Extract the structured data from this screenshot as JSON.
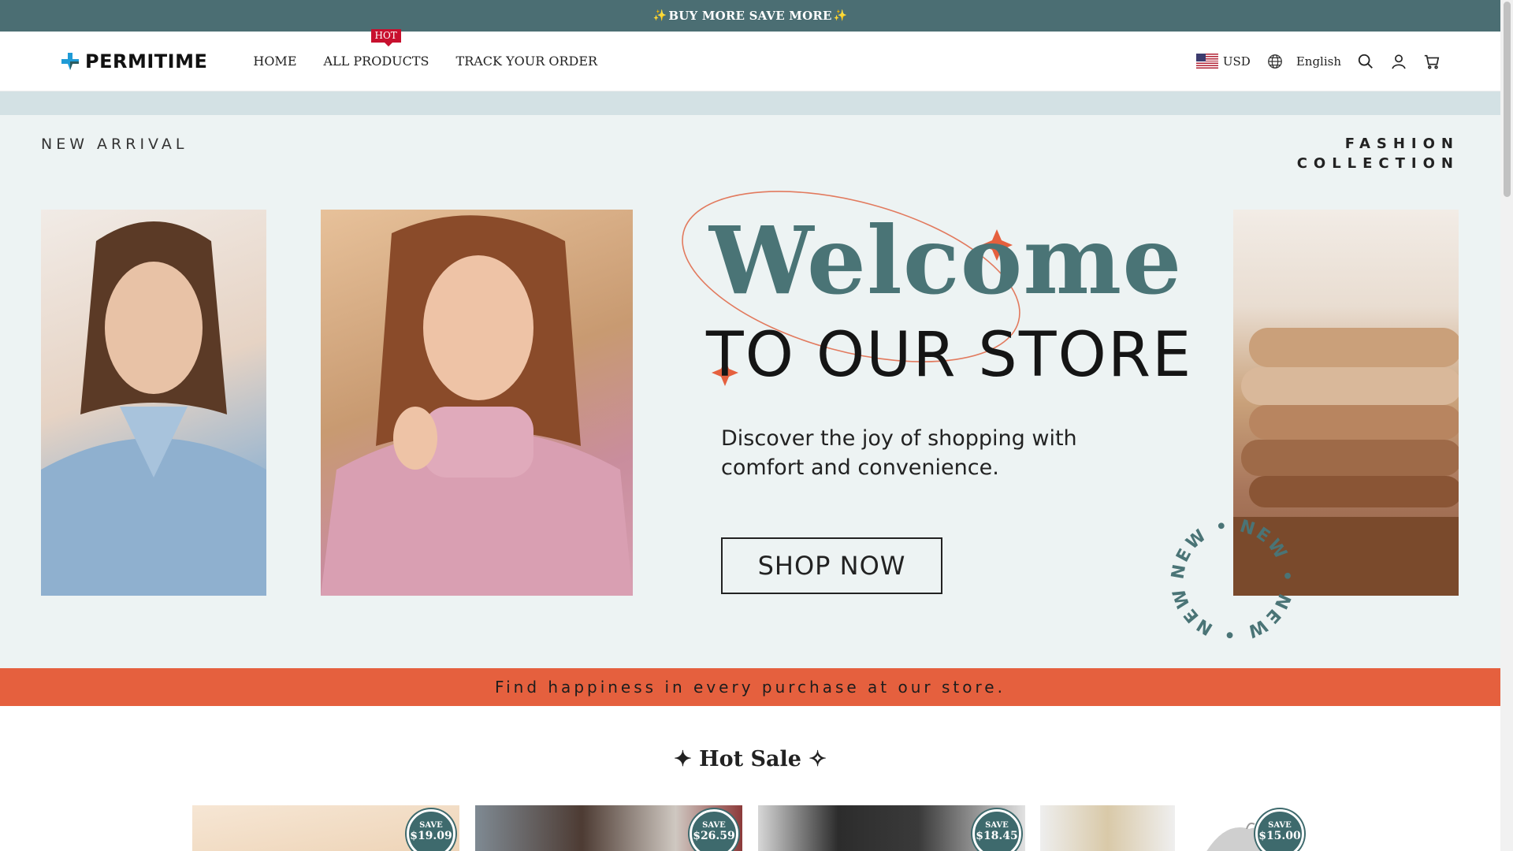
{
  "announcement": {
    "text": "BUY MORE SAVE MORE",
    "star": "✨"
  },
  "header": {
    "logo_text": "PERMITIME",
    "nav": [
      {
        "label": "HOME"
      },
      {
        "label": "ALL PRODUCTS",
        "badge": "HOT"
      },
      {
        "label": "TRACK YOUR ORDER"
      }
    ],
    "currency": "USD",
    "language": "English",
    "icons": [
      "globe-icon",
      "search-icon",
      "account-icon",
      "cart-icon"
    ]
  },
  "hero": {
    "new_arrival": "NEW ARRIVAL",
    "fashion_line1": "FASHION",
    "fashion_line2": "COLLECTION",
    "welcome": "Welcome",
    "to_store": "TO OUR STORE",
    "tagline": "Discover the joy of shopping with comfort and convenience.",
    "cta": "SHOP NOW",
    "ring_text": "NEW • NEW • NEW • NEW •"
  },
  "promo": {
    "text": "Find happiness in every purchase at our store."
  },
  "hot_sale": {
    "title": "✦ Hot Sale ✧",
    "save_label": "SAVE",
    "products": [
      {
        "save": "$19.09"
      },
      {
        "save": "$26.59"
      },
      {
        "save": "$18.45"
      },
      {
        "save": ""
      },
      {
        "save": "$15.00"
      }
    ]
  },
  "colors": {
    "announcement_bg": "#4b6e73",
    "accent_teal": "#4a7476",
    "promo_bg": "#e5603e",
    "hot_badge": "#c8102e"
  }
}
